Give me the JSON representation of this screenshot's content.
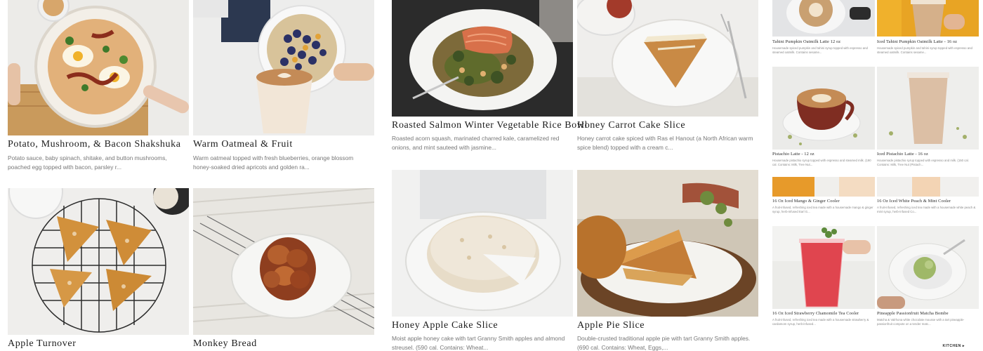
{
  "main_grid": {
    "items": [
      {
        "title": "Potato, Mushroom, & Bacon Shakshuka",
        "description": "Potato sauce, baby spinach, shitake, and button mushrooms, poached egg topped with bacon, parsley r..."
      },
      {
        "title": "Warm Oatmeal & Fruit",
        "description": "Warm oatmeal topped with fresh blueberries, orange blossom honey-soaked dried apricots and golden ra..."
      },
      {
        "title": "Apple Turnover",
        "description": ""
      },
      {
        "title": "Monkey Bread",
        "description": ""
      }
    ]
  },
  "center_grid": {
    "items": [
      {
        "title": "Roasted Salmon Winter Vegetable Rice Bowl",
        "description": "Roasted acorn squash, marinated charred kale, caramelized red onions, and mint sauteed with jasmine..."
      },
      {
        "title": "Honey Carrot Cake Slice",
        "description": "Honey carrot cake spiced with Ras el Hanout (a North African warm spice blend) topped with a cream c..."
      },
      {
        "title": "Honey Apple Cake Slice",
        "description": "Moist apple honey cake with tart Granny Smith apples and almond streusel. (590 cal. Contains: Wheat..."
      },
      {
        "title": "Apple Pie Slice",
        "description": "Double-crusted traditional apple pie with tart Granny Smith apples. (690 cal. Contains: Wheat, Eggs,..."
      }
    ]
  },
  "side_grid": {
    "items": [
      {
        "title": "Tahini Pumpkin Oatmilk Latte 12 oz",
        "description": "Housemade spiced pumpkin and tahini syrup topped with espresso and steamed oatmilk. Contains sesame..."
      },
      {
        "title": "Iced Tahini Pumpkin Oatmilk Latte - 16 oz",
        "description": "Housemade spiced pumpkin and tahini syrup topped with espresso and steamed oatmilk. Contains sesame..."
      },
      {
        "title": "Pistachio Latte - 12 oz",
        "description": "Housemade pistachio syrup topped with espresso and steamed milk. (190 cal. Contains: Milk, Tree Nut..."
      },
      {
        "title": "Iced Pistachio Latte - 16 oz",
        "description": "Housemade pistachio syrup topped with espresso and milk. (150 cal. Contains: Milk, Tree Nut (Pistach..."
      },
      {
        "title": "16 Oz Iced Mango & Ginger Cooler",
        "description": "A fruit-infused, refreshing iced tea made with a housemade mango & ginger syrup, herb-infused Earl G..."
      },
      {
        "title": "16 Oz Iced White Peach & Mint Cooler",
        "description": "A fruit-infused, refreshing iced tea made with a housemade white peach & mint syrup, herb-infused Co..."
      },
      {
        "title": "16 Oz Iced Strawberry Chamomile Tea Cooler",
        "description": "A fruit-infused, refreshing iced tea made with a housemade strawberry & cardamom syrup, herb-infused..."
      },
      {
        "title": "Pineapple Passionfruit Matcha Bombe",
        "description": "Matcha & Valrhona white chocolate mousse with a tart pineapple-passionfruit compote on a tender matc..."
      }
    ]
  },
  "brand": {
    "label": "KITCHEN ▸"
  }
}
